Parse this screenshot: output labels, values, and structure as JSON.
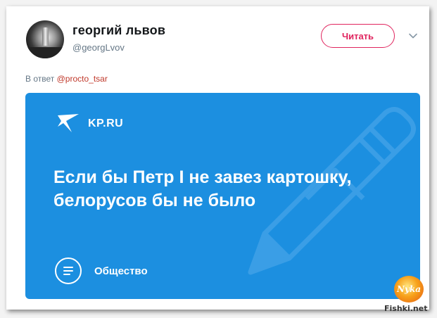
{
  "tweet": {
    "author_name": "георгий львов",
    "author_handle": "@georgLvov",
    "follow_label": "Читать",
    "reply_prefix": "В ответ",
    "reply_mention": "@procto_tsar"
  },
  "card": {
    "brand": "KP.RU",
    "headline": "Если бы Петр I не завез картошку, белорусов бы не было",
    "category": "Общество",
    "background_color": "#1c8fe0"
  },
  "overlay": {
    "badge_text": "Nyka",
    "watermark": "Fishki.net"
  },
  "colors": {
    "accent": "#e0245e",
    "mention": "#c0392b"
  }
}
